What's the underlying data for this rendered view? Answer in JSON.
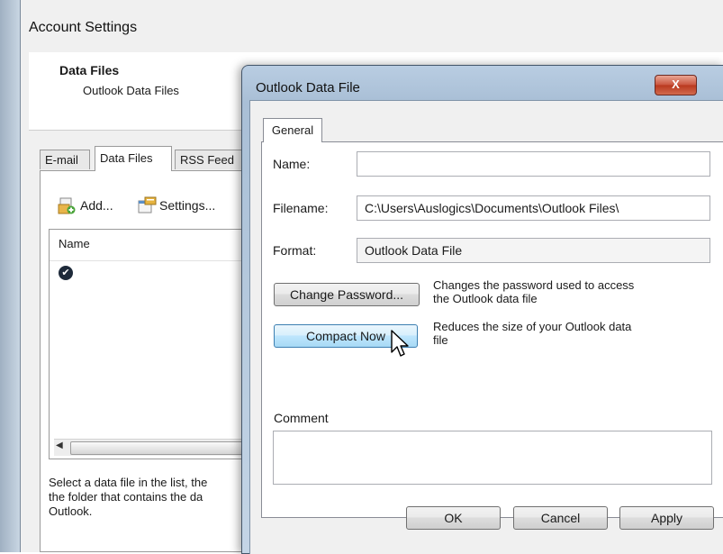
{
  "account_settings": {
    "title": "Account Settings",
    "header_title": "Data Files",
    "header_subtitle": "Outlook Data Files",
    "tabs": [
      {
        "label": "E-mail"
      },
      {
        "label": "Data Files"
      },
      {
        "label": "RSS Feed"
      }
    ],
    "toolbar": {
      "add_label": "Add...",
      "settings_label": "Settings..."
    },
    "list": {
      "column_name": "Name"
    },
    "footer_lines": [
      "Select a data file in the list, the",
      "the folder that contains the da",
      "Outlook."
    ]
  },
  "dialog": {
    "title": "Outlook Data File",
    "close_glyph": "X",
    "tab_general": "General",
    "name_label": "Name:",
    "name_value": "",
    "filename_label": "Filename:",
    "filename_value": "C:\\Users\\Auslogics\\Documents\\Outlook Files\\",
    "format_label": "Format:",
    "format_value": "Outlook Data File",
    "change_password_label": "Change Password...",
    "change_password_desc_lines": [
      "Changes the password used to access",
      "the Outlook data file"
    ],
    "compact_now_label": "Compact Now",
    "compact_now_desc_lines": [
      "Reduces the size of your Outlook data",
      "file"
    ],
    "comment_label": "Comment",
    "comment_value": "",
    "ok_label": "OK",
    "cancel_label": "Cancel",
    "apply_label": "Apply"
  },
  "icons": {
    "add": "add-file-icon",
    "settings": "settings-icon",
    "default_check": "check-circle-icon",
    "close": "close-icon",
    "cursor": "mouse-pointer-icon"
  },
  "colors": {
    "title_bar": "#b9cde2",
    "close_button": "#c9533c",
    "hover_button": "#bee6fd"
  }
}
